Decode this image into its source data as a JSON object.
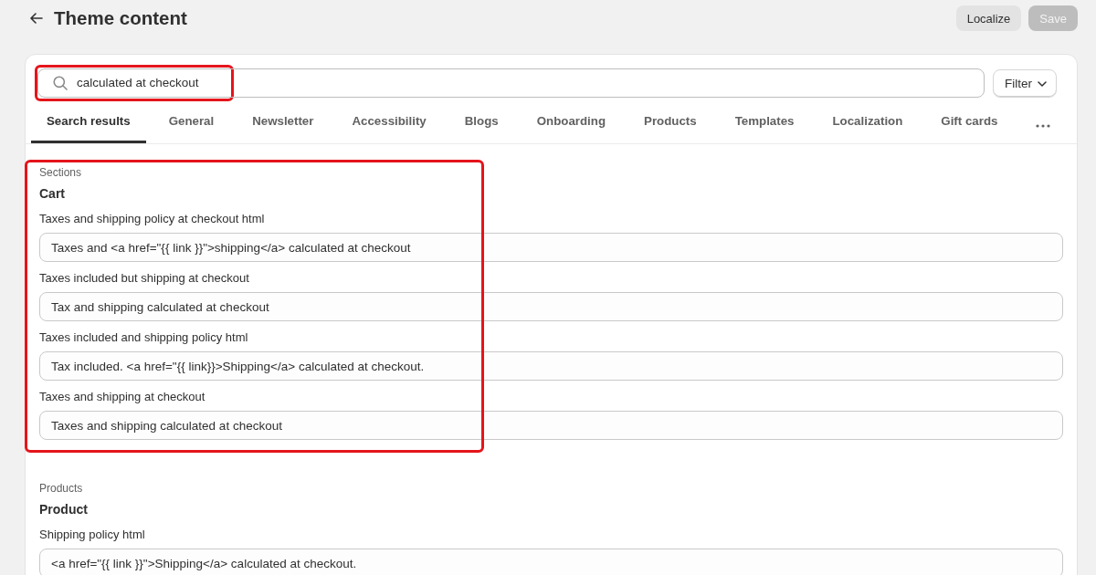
{
  "header": {
    "title": "Theme content",
    "buttons": [
      {
        "label": "Localize",
        "disabled": false
      },
      {
        "label": "Save",
        "disabled": true
      }
    ]
  },
  "search": {
    "value": "calculated at checkout",
    "highlighted": true
  },
  "filter_button": {
    "label": "Filter"
  },
  "tabs": [
    {
      "label": "Search results",
      "selected": true
    },
    {
      "label": "General",
      "selected": false
    },
    {
      "label": "Newsletter",
      "selected": false
    },
    {
      "label": "Accessibility",
      "selected": false
    },
    {
      "label": "Blogs",
      "selected": false
    },
    {
      "label": "Onboarding",
      "selected": false
    },
    {
      "label": "Products",
      "selected": false
    },
    {
      "label": "Templates",
      "selected": false
    },
    {
      "label": "Localization",
      "selected": false
    },
    {
      "label": "Gift cards",
      "selected": false
    }
  ],
  "groups": [
    {
      "category": "Sections",
      "title": "Cart",
      "highlighted": true,
      "fields": [
        {
          "label": "Taxes and shipping policy at checkout html",
          "value": "Taxes and <a href=\"{{ link }}\">shipping</a> calculated at checkout"
        },
        {
          "label": "Taxes included but shipping at checkout",
          "value": "Tax and shipping calculated at checkout"
        },
        {
          "label": "Taxes included and shipping policy html",
          "value": "Tax included. <a href=\"{{ link}}>Shipping</a> calculated at checkout."
        },
        {
          "label": "Taxes and shipping at checkout",
          "value": "Taxes and shipping calculated at checkout"
        }
      ]
    },
    {
      "category": "Products",
      "title": "Product",
      "highlighted": false,
      "fields": [
        {
          "label": "Shipping policy html",
          "value": "<a href=\"{{ link }}\">Shipping</a> calculated at checkout."
        }
      ]
    }
  ]
}
